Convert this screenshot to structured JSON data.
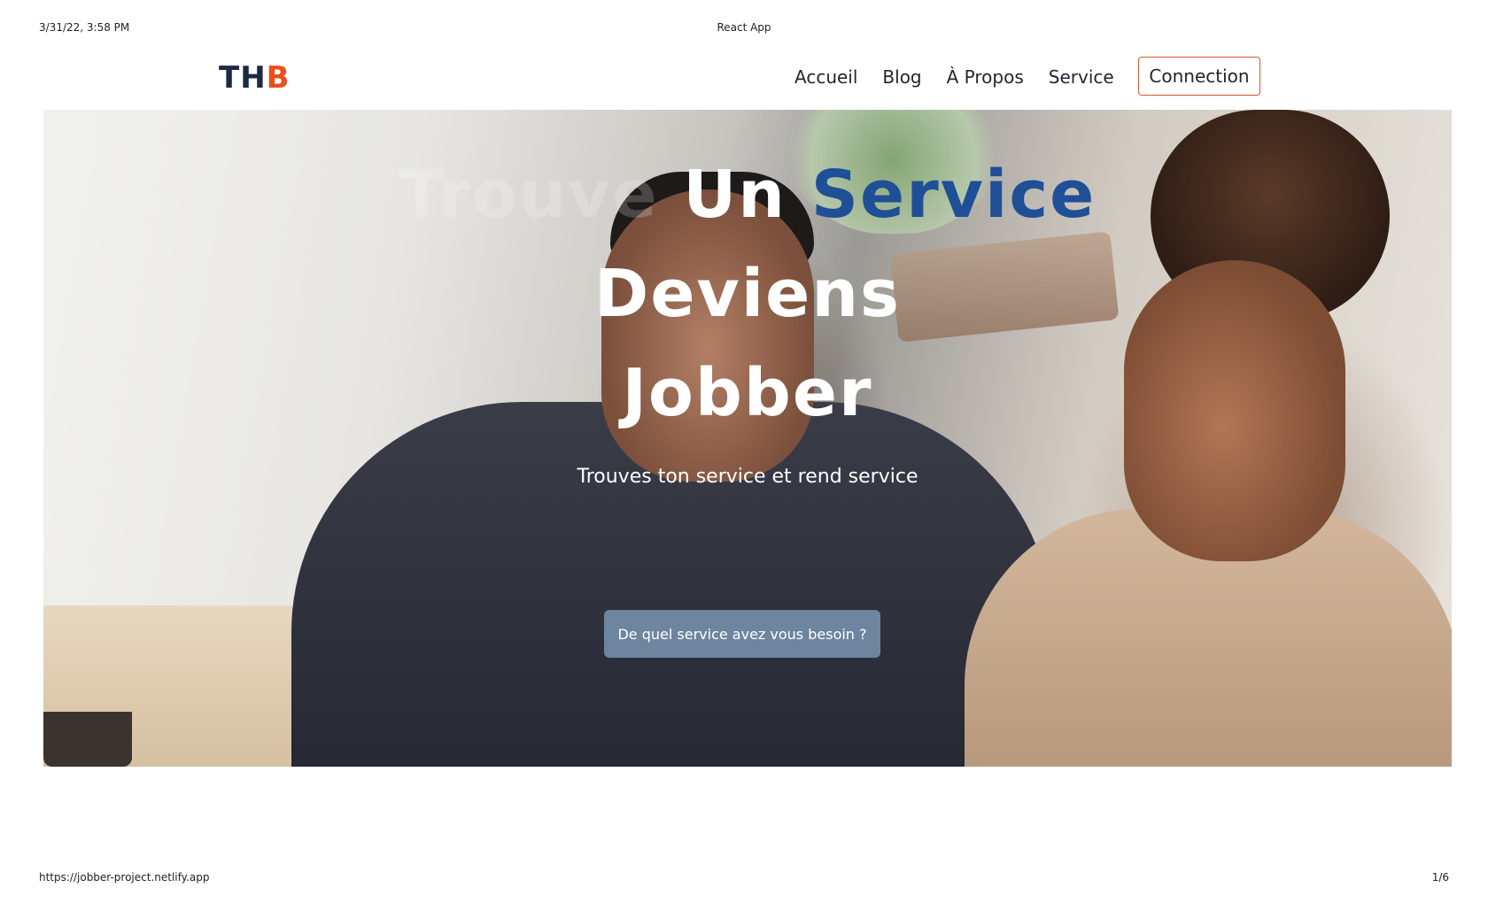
{
  "print_header": {
    "datetime": "3/31/22, 3:58 PM",
    "page_title": "React App"
  },
  "print_footer": {
    "url": "https://jobber-project.netlify.app",
    "page": "1/6"
  },
  "navbar": {
    "logo_main": "TH",
    "logo_accent": "B",
    "links": [
      "Accueil",
      "Blog",
      "À Propos",
      "Service"
    ],
    "connect_label": "Connection"
  },
  "hero": {
    "title_faded": "Trouve",
    "title_plain": "Un",
    "title_blue": "Service",
    "title_line2": "Deviens",
    "title_line3": "Jobber",
    "subtitle": "Trouves ton service et rend service",
    "cta_label": "De quel service avez vous besoin ?"
  },
  "colors": {
    "brand_accent": "#e8501e",
    "title_blue": "#1f4f97",
    "cta_bg": "#6e85a0"
  }
}
